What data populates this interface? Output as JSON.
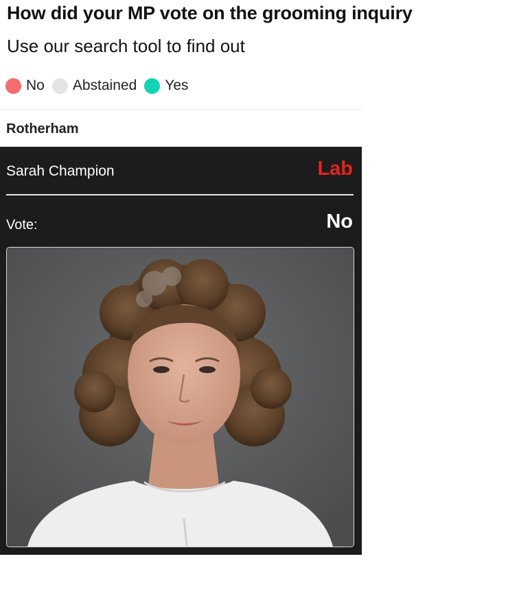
{
  "header": {
    "title": "How did your MP vote on the grooming inquiry",
    "subtitle": "Use our search tool to find out"
  },
  "legend": {
    "items": [
      {
        "label": "No",
        "color": "#f26d6d"
      },
      {
        "label": "Abstained",
        "color": "#e3e3e3"
      },
      {
        "label": "Yes",
        "color": "#13d4b2"
      }
    ]
  },
  "result_card": {
    "constituency": "Rotherham",
    "mp_name": "Sarah Champion",
    "party": "Lab",
    "party_color": "#e4241c",
    "vote_label": "Vote:",
    "vote_value": "No",
    "photo_icon": "mp-portrait"
  }
}
